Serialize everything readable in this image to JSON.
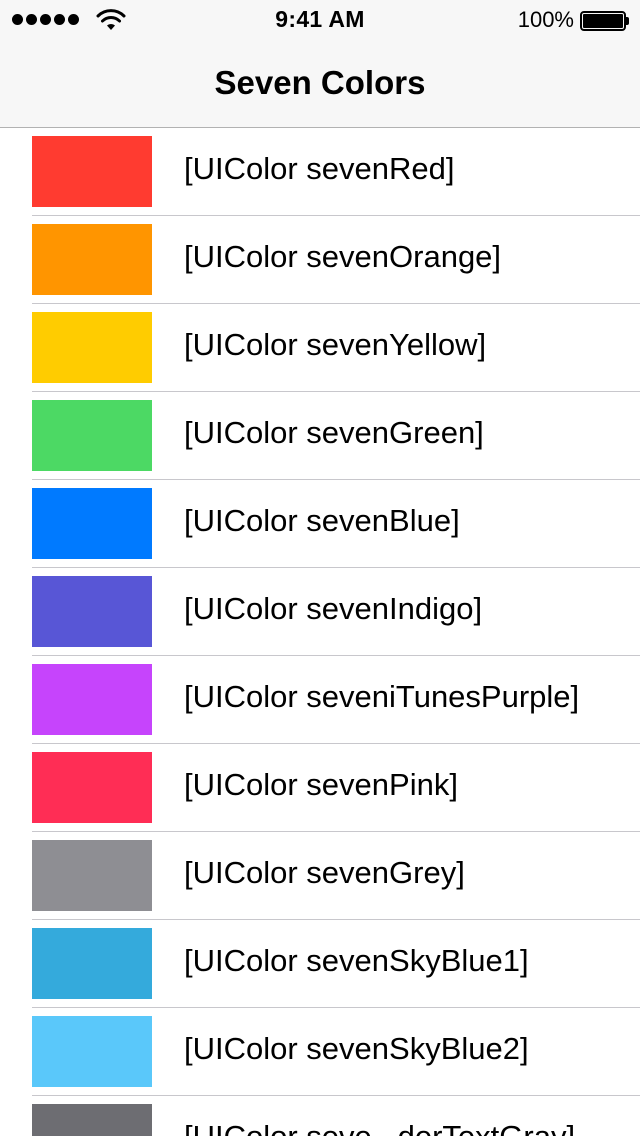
{
  "status_bar": {
    "time": "9:41 AM",
    "battery": "100%",
    "signal_icon": "signal-dots-icon",
    "wifi_icon": "wifi-icon",
    "battery_icon": "battery-icon"
  },
  "nav": {
    "title": "Seven Colors"
  },
  "colors": [
    {
      "label": "[UIColor sevenRed]",
      "hex": "#ff3b30"
    },
    {
      "label": "[UIColor sevenOrange]",
      "hex": "#ff9500"
    },
    {
      "label": "[UIColor sevenYellow]",
      "hex": "#ffcc00"
    },
    {
      "label": "[UIColor sevenGreen]",
      "hex": "#4cd964"
    },
    {
      "label": "[UIColor sevenBlue]",
      "hex": "#007aff"
    },
    {
      "label": "[UIColor sevenIndigo]",
      "hex": "#5856d6"
    },
    {
      "label": "[UIColor seveniTunesPurple]",
      "hex": "#c644fc"
    },
    {
      "label": "[UIColor sevenPink]",
      "hex": "#ff2d55"
    },
    {
      "label": "[UIColor sevenGrey]",
      "hex": "#8e8e93"
    },
    {
      "label": "[UIColor sevenSkyBlue1]",
      "hex": "#34aadc"
    },
    {
      "label": "[UIColor sevenSkyBlue2]",
      "hex": "#5ac8fa"
    },
    {
      "label": "[UIColor seve...derTextGray]",
      "hex": "#6d6d72"
    }
  ]
}
